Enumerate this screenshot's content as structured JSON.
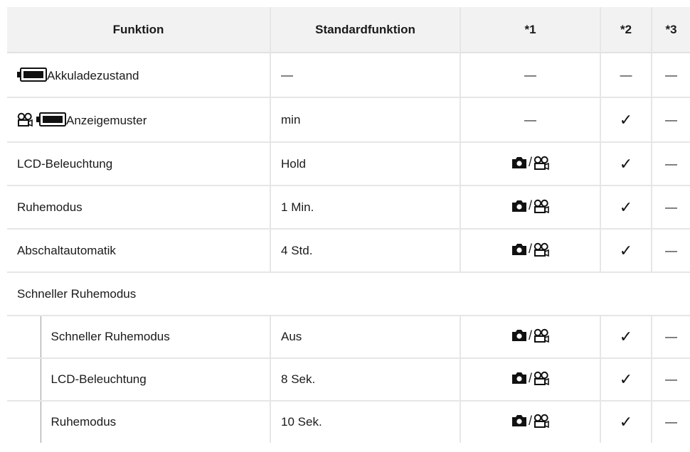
{
  "headers": {
    "funktion": "Funktion",
    "standard": "Standardfunktion",
    "n1": "*1",
    "n2": "*2",
    "n3": "*3"
  },
  "rows": [
    {
      "label": "Akkuladezustand",
      "icons": [
        "battery-icon"
      ],
      "standard": "—",
      "n1": "—",
      "n2": "—",
      "n3": "—"
    },
    {
      "label": "Anzeigemuster",
      "icons": [
        "movie-icon",
        "battery-icon"
      ],
      "standard": "min",
      "n1": "—",
      "n2": "✓",
      "n3": "—"
    },
    {
      "label": "LCD-Beleuchtung",
      "standard": "Hold",
      "n1": "camera/movie",
      "n2": "✓",
      "n3": "—"
    },
    {
      "label": "Ruhemodus",
      "standard": "1 Min.",
      "n1": "camera/movie",
      "n2": "✓",
      "n3": "—"
    },
    {
      "label": "Abschaltautomatik",
      "standard": "4 Std.",
      "n1": "camera/movie",
      "n2": "✓",
      "n3": "—"
    }
  ],
  "group": {
    "label": "Schneller Ruhemodus",
    "rows": [
      {
        "label": "Schneller Ruhemodus",
        "standard": "Aus",
        "n1": "camera/movie",
        "n2": "✓",
        "n3": "—"
      },
      {
        "label": "LCD-Beleuchtung",
        "standard": "8 Sek.",
        "n1": "camera/movie",
        "n2": "✓",
        "n3": "—"
      },
      {
        "label": "Ruhemodus",
        "standard": "10 Sek.",
        "n1": "camera/movie",
        "n2": "✓",
        "n3": "—"
      }
    ]
  },
  "symbols": {
    "slash": "/",
    "dash": "—",
    "check": "✓"
  }
}
